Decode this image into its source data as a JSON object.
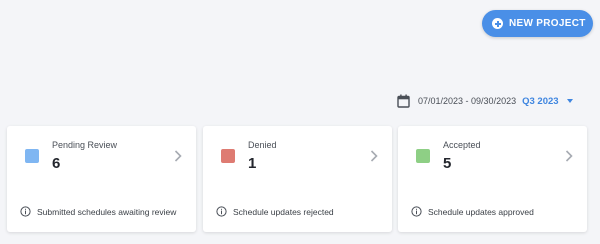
{
  "header": {
    "new_project_label": "NEW PROJECT"
  },
  "period": {
    "date_range": "07/01/2023 - 09/30/2023",
    "quarter": "Q3 2023"
  },
  "cards": [
    {
      "title": "Pending Review",
      "count": "6",
      "description": "Submitted schedules awaiting review",
      "color": "#7fb6f2"
    },
    {
      "title": "Denied",
      "count": "1",
      "description": "Schedule updates rejected",
      "color": "#de7b72"
    },
    {
      "title": "Accepted",
      "count": "5",
      "description": "Schedule updates approved",
      "color": "#8ecf85"
    }
  ],
  "colors": {
    "accent": "#4a8fe7",
    "background": "#f4f5f8"
  }
}
